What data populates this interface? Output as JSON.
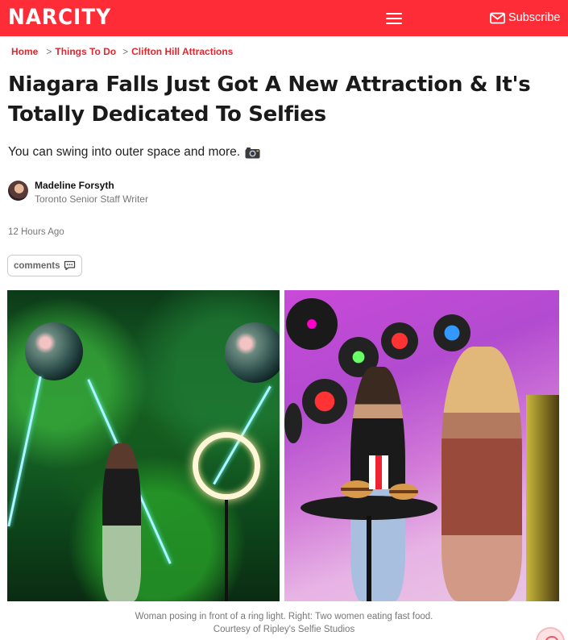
{
  "header": {
    "logo": "NARCITY",
    "menu_icon": "hamburger-menu-icon",
    "subscribe_label": "Subscribe",
    "subscribe_icon": "mail-icon",
    "brand_color": "#fe2c37"
  },
  "breadcrumb": {
    "items": [
      "Home",
      "Things To Do",
      "Clifton Hill Attractions"
    ],
    "separator": ">"
  },
  "article": {
    "headline": "Niagara Falls Just Got A New Attraction & It's Totally Dedicated To Selfies",
    "subhead": "You can swing into outer space and more.",
    "subhead_icon": "camera-icon",
    "author_name": "Madeline Forsyth",
    "author_role": "Toronto Senior Staff Writer",
    "timestamp": "12 Hours Ago",
    "comments_label": "comments",
    "comments_icon": "speech-bubble-icon"
  },
  "media": {
    "caption_line1": "Woman posing in front of a ring light. Right: Two women eating fast food.",
    "caption_line2": "Courtesy of Ripley's Selfie Studios"
  },
  "colors": {
    "link": "#e1262e",
    "meta_text": "#777777"
  }
}
